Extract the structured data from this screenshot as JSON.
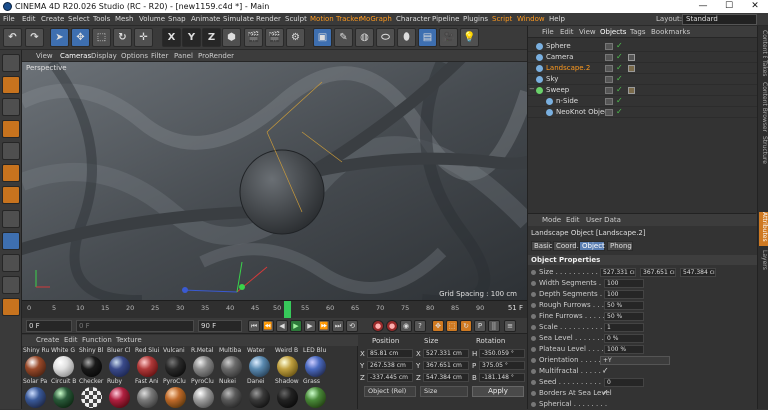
{
  "window": {
    "title": "CINEMA 4D R20.026 Studio (RC - R20) - [new1159.c4d *] - Main",
    "minimize": "—",
    "maximize": "☐",
    "close": "✕"
  },
  "menu": {
    "items": [
      "File",
      "Edit",
      "Create",
      "Select",
      "Tools",
      "Mesh",
      "Volume",
      "Snap",
      "Animate",
      "Simulate",
      "Render",
      "Sculpt",
      "Motion Tracker",
      "MoGraph",
      "Character",
      "Pipeline",
      "Plugins",
      "Script",
      "Window",
      "Help"
    ],
    "layout_label": "Layout:",
    "layout_value": "Standard"
  },
  "toolbar": {
    "axis_x": "X",
    "axis_y": "Y",
    "axis_z": "Z"
  },
  "viewport": {
    "menu": [
      "View",
      "Cameras",
      "Display",
      "Options",
      "Filter",
      "Panel",
      "ProRender"
    ],
    "label": "Perspective",
    "grid_spacing": "Grid Spacing : 100 cm"
  },
  "timeline": {
    "ticks": [
      "0",
      "5",
      "10",
      "15",
      "20",
      "25",
      "30",
      "35",
      "40",
      "45",
      "50",
      "55",
      "60",
      "65",
      "70",
      "75",
      "80",
      "85",
      "90"
    ],
    "current_frame_label": "51 F",
    "current_frame_value": 51,
    "start_field": "0 F",
    "current_field": "0 F",
    "end_field": "90 F",
    "end_field2": "90 F"
  },
  "materials": {
    "menu": [
      "Create",
      "Edit",
      "Function",
      "Texture"
    ],
    "row1": [
      {
        "label": "Shiny Ru",
        "color": "#9a4a2a"
      },
      {
        "label": "White G",
        "color": "#e0e0e0"
      },
      {
        "label": "Shiny Bl",
        "color": "#1a1a1a"
      },
      {
        "label": "Bluer Cl",
        "color": "#3a4a8a"
      },
      {
        "label": "Red Slui",
        "color": "#b03a3a"
      },
      {
        "label": "Vulcani",
        "color": "#2a2a2a"
      },
      {
        "label": "R.Metal",
        "color": "#8a8a8a"
      },
      {
        "label": "Multiba",
        "color": "#6a6a6a"
      },
      {
        "label": "Water",
        "color": "#5a8ab0"
      },
      {
        "label": "Weird B",
        "color": "#c0a040"
      },
      {
        "label": "LED Blu",
        "color": "#4a6ac0"
      }
    ],
    "row2": [
      {
        "label": "Solar Pa",
        "color": "#3a5a9a"
      },
      {
        "label": "Circuit B",
        "color": "#2a5a3a"
      },
      {
        "label": "Checker",
        "color": "#bbbbbb"
      },
      {
        "label": "Ruby",
        "color": "#b02040"
      },
      {
        "label": "Fast Ani",
        "color": "#7a7a7a"
      },
      {
        "label": "PyroClu",
        "color": "#c06a2a"
      },
      {
        "label": "PyroClu",
        "color": "#a0a0a0"
      },
      {
        "label": "Nukei",
        "color": "#5a5a5a"
      },
      {
        "label": "Danei",
        "color": "#3a3a3a"
      },
      {
        "label": "Shadow",
        "color": "#222222"
      },
      {
        "label": "Grass",
        "color": "#4a8a3a"
      }
    ]
  },
  "coords": {
    "headers": [
      "Position",
      "Size",
      "Rotation"
    ],
    "rows": [
      {
        "axis": "X",
        "pos": "85.81 cm",
        "size_axis": "X",
        "size": "527.331 cm",
        "rot_axis": "H",
        "rot": "-350.059 °"
      },
      {
        "axis": "Y",
        "pos": "267.538 cm",
        "size_axis": "Y",
        "size": "367.651 cm",
        "rot_axis": "P",
        "rot": "375.05 °"
      },
      {
        "axis": "Z",
        "pos": "-337.445 cm",
        "size_axis": "Z",
        "size": "547.384 cm",
        "rot_axis": "B",
        "rot": "-181.148 °"
      }
    ],
    "mode": "Object (Rel)",
    "size_mode": "Size",
    "apply": "Apply"
  },
  "object_manager": {
    "tabs": [
      "File",
      "Edit",
      "View",
      "Objects",
      "Tags",
      "Bookmarks"
    ],
    "objects": [
      {
        "name": "Sphere",
        "indent": 0,
        "color": "#7ab0e0",
        "selected": false
      },
      {
        "name": "Camera",
        "indent": 0,
        "color": "#7ab0e0",
        "selected": false
      },
      {
        "name": "Landscape.2",
        "indent": 0,
        "color": "#7ab0e0",
        "selected": true
      },
      {
        "name": "Sky",
        "indent": 0,
        "color": "#7ab0e0",
        "selected": false
      },
      {
        "name": "Sweep",
        "indent": 0,
        "color": "#6ad06a",
        "selected": false
      },
      {
        "name": "n-Side",
        "indent": 1,
        "color": "#7ab0e0",
        "selected": false
      },
      {
        "name": "NeoKnot Object",
        "indent": 1,
        "color": "#7ab0e0",
        "selected": false
      }
    ]
  },
  "side_tabs": [
    "Content Browser",
    "Takes",
    "Content Browser",
    "Structure",
    "Attributes",
    "Layers"
  ],
  "attributes": {
    "menu": [
      "Mode",
      "Edit",
      "User Data"
    ],
    "object_title": "Landscape Object [Landscape.2]",
    "tabs": [
      "Basic",
      "Coord.",
      "Object",
      "Phong"
    ],
    "section": "Object Properties",
    "rows": [
      {
        "label": "Size . . . . . . . . . . .",
        "values": [
          "527.331 cı",
          "367.651 cı",
          "547.384 cı"
        ]
      },
      {
        "label": "Width Segments . . .",
        "values": [
          "100"
        ]
      },
      {
        "label": "Depth Segments . . .",
        "values": [
          "100"
        ]
      },
      {
        "label": "Rough Furrows . . . .",
        "values": [
          "50 %"
        ]
      },
      {
        "label": "Fine Furrows . . . . .",
        "values": [
          "50 %"
        ]
      },
      {
        "label": "Scale . . . . . . . . . .",
        "values": [
          "1"
        ]
      },
      {
        "label": "Sea Level . . . . . . . .",
        "values": [
          "0 %"
        ]
      },
      {
        "label": "Plateau Level . . . . .",
        "values": [
          "100 %"
        ]
      },
      {
        "label": "Orientation . . . . . . .",
        "select": "+Y"
      },
      {
        "label": "Multifractal . . . . . .",
        "check": "✓"
      },
      {
        "label": "Seed . . . . . . . . . . .",
        "values": [
          "0"
        ]
      },
      {
        "label": "Borders At Sea Level",
        "check": "✓"
      },
      {
        "label": "Spherical . . . . . . . .",
        "check": ""
      }
    ]
  }
}
